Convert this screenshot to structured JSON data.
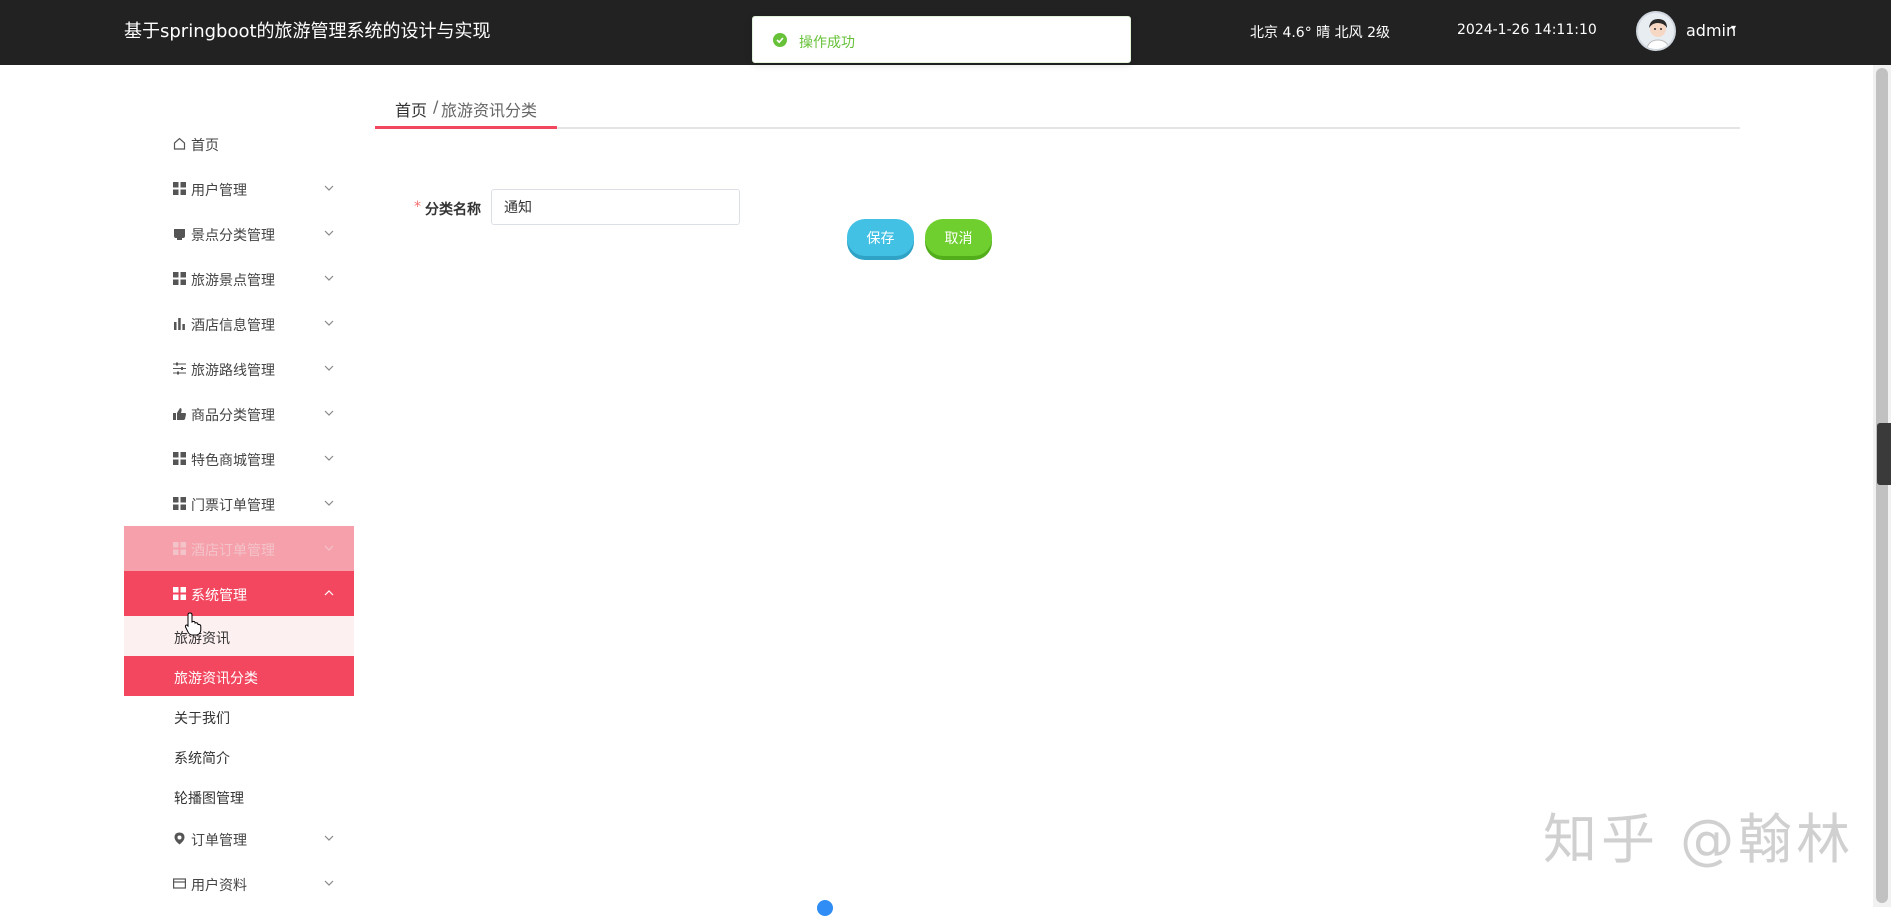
{
  "header": {
    "title": "基于springboot的旅游管理系统的设计与实现",
    "weather": "北京  4.6°  晴  北风  2级",
    "datetime": "2024-1-26 14:11:10",
    "user": "admin",
    "caret": "▾"
  },
  "toast": {
    "message": "操作成功",
    "type": "success",
    "color": "#67c23a"
  },
  "sidebar": {
    "items": [
      {
        "label": "首页",
        "icon": "home-icon"
      },
      {
        "label": "用户管理",
        "icon": "grid-icon"
      },
      {
        "label": "景点分类管理",
        "icon": "folder-icon"
      },
      {
        "label": "旅游景点管理",
        "icon": "grid-icon"
      },
      {
        "label": "酒店信息管理",
        "icon": "bar-chart-icon"
      },
      {
        "label": "旅游路线管理",
        "icon": "sliders-icon"
      },
      {
        "label": "商品分类管理",
        "icon": "thumb-icon"
      },
      {
        "label": "特色商城管理",
        "icon": "grid-icon"
      },
      {
        "label": "门票订单管理",
        "icon": "grid-icon"
      },
      {
        "label": "酒店订单管理",
        "icon": "grid-icon"
      },
      {
        "label": "系统管理",
        "icon": "grid-icon",
        "expanded": true
      },
      {
        "label": "订单管理",
        "icon": "location-icon"
      },
      {
        "label": "用户资料",
        "icon": "card-icon"
      }
    ],
    "sub_items": [
      {
        "label": "旅游资讯"
      },
      {
        "label": "旅游资讯分类",
        "active": true
      },
      {
        "label": "关于我们"
      },
      {
        "label": "系统简介"
      },
      {
        "label": "轮播图管理"
      }
    ],
    "active_color": "#f2475f"
  },
  "breadcrumb": {
    "home": "首页",
    "separator": "/",
    "current": "旅游资讯分类"
  },
  "form": {
    "required_mark": "*",
    "category_label": "分类名称",
    "category_value": "通知",
    "save_label": "保存",
    "cancel_label": "取消"
  },
  "watermark": "知乎 @翰林"
}
